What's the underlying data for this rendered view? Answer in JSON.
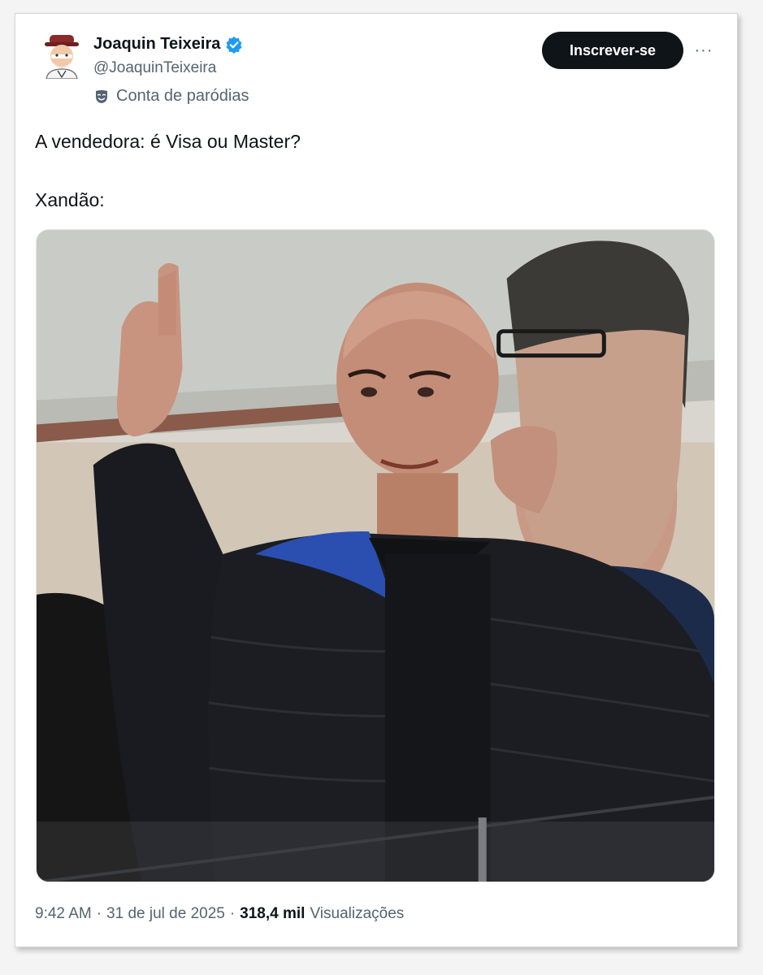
{
  "tweet": {
    "author_name": "Joaquin Teixeira",
    "author_handle": "@JoaquinTeixeira",
    "parody_label": "Conta de paródias",
    "subscribe_label": "Inscrever-se",
    "more_label": "···",
    "text_line_1": "A vendedora: é Visa ou Master?",
    "text_line_2": "Xandão:",
    "time": "9:42 AM",
    "date": "31 de jul de 2025",
    "view_count": "318,4 mil",
    "view_label": "Visualizações",
    "separator": "·"
  },
  "icons": {
    "verified": "verified-badge-icon",
    "parody": "theater-mask-icon",
    "more": "more-options-icon"
  },
  "colors": {
    "verified_blue": "#1d9bf0",
    "subscribe_bg": "#0f1419",
    "secondary_text": "#536471"
  }
}
